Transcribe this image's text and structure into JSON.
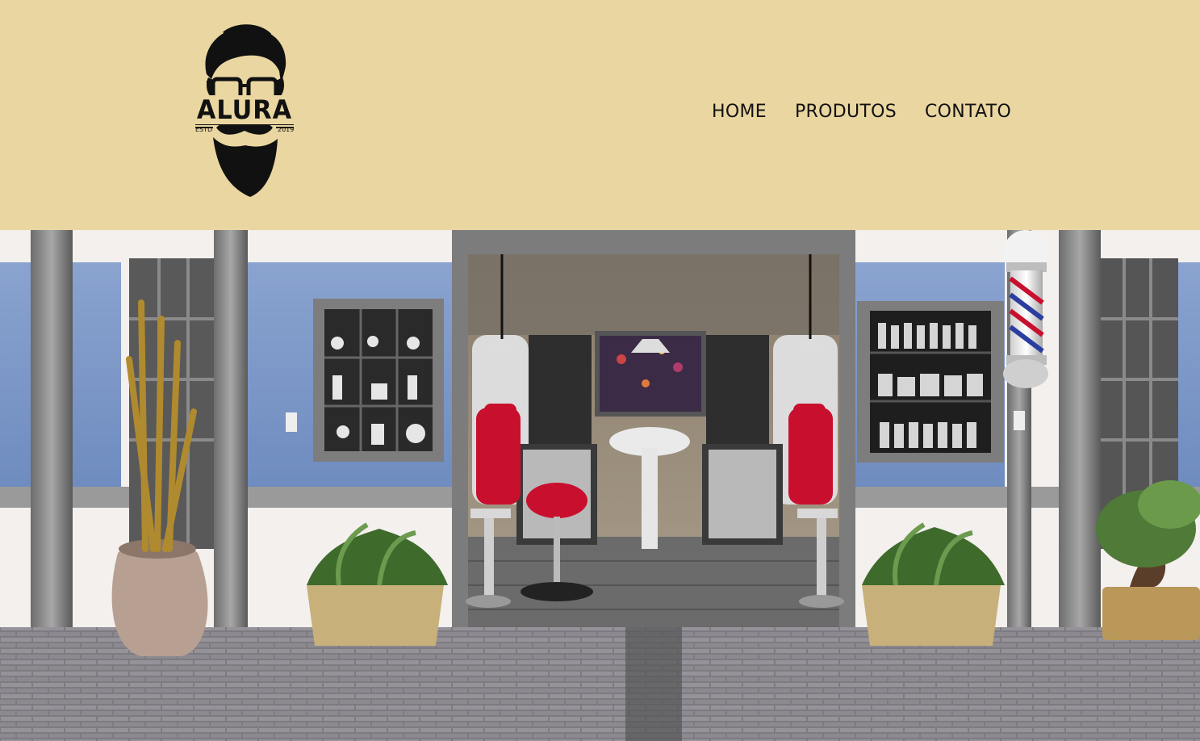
{
  "brand": {
    "name": "ALURA",
    "estd_label": "ESTD",
    "year": "2019",
    "logo_icon": "bearded-man-glasses-icon"
  },
  "nav": {
    "items": [
      {
        "label": "HOME"
      },
      {
        "label": "PRODUTOS"
      },
      {
        "label": "CONTATO"
      }
    ]
  },
  "colors": {
    "header_bg": "#ead6a1",
    "nav_text": "#111111",
    "chair_red": "#c8102e"
  },
  "hero": {
    "image_icon": "barbershop-storefront-illustration"
  }
}
